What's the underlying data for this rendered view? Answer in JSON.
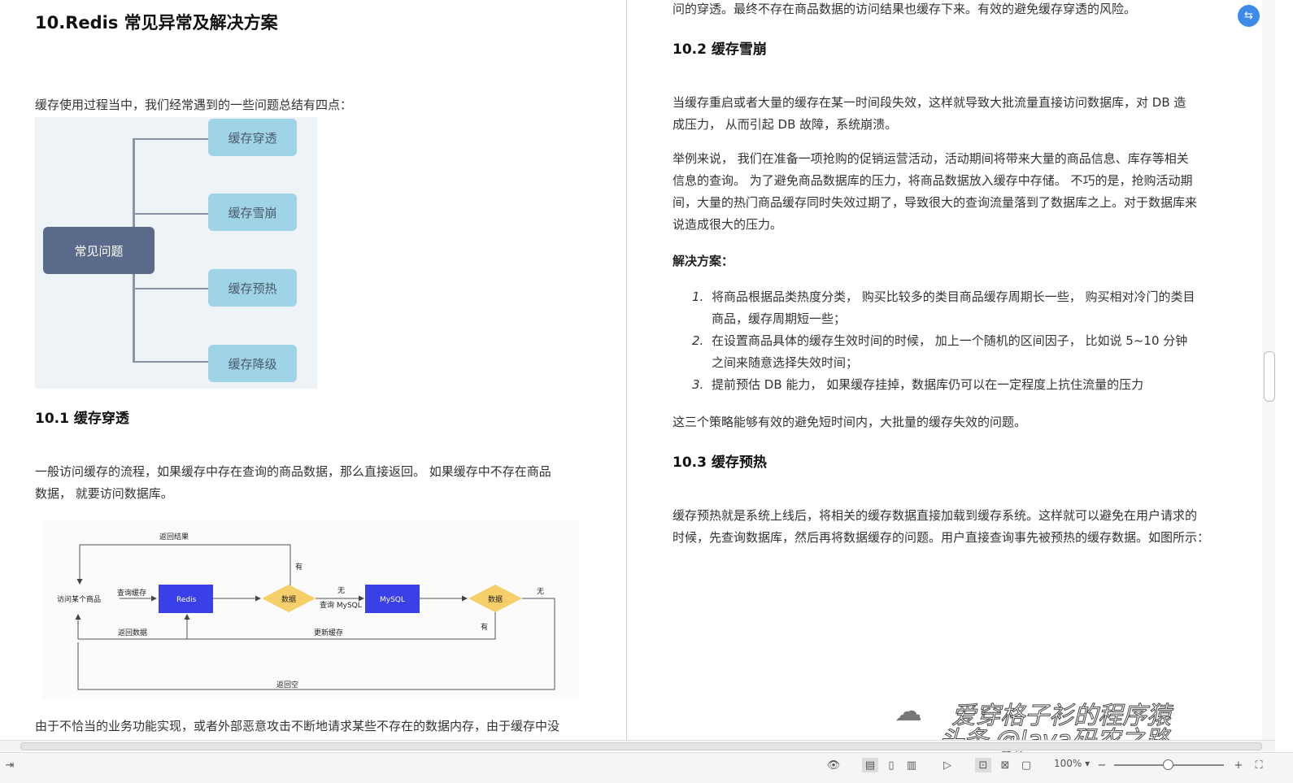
{
  "left_page": {
    "section_title": "10.Redis 常见异常及解决方案",
    "intro": "缓存使用过程当中，我们经常遇到的一些问题总结有四点：",
    "mindmap": {
      "root": "常见问题",
      "nodes": [
        "缓存穿透",
        "缓存雪崩",
        "缓存预热",
        "缓存降级"
      ]
    },
    "sub_title_1": "10.1  缓存穿透",
    "para_1a": "一般访问缓存的流程，如果缓存中存在查询的商品数据，那么直接返回。  如果缓存中不存在商品",
    "para_1b": "数据，  就要访问数据库。",
    "flow": {
      "start": "访问某个商品",
      "query_cache": "查询缓存",
      "redis": "Redis",
      "data1": "数据",
      "yes1": "有",
      "no1": "无",
      "query_mysql": "查询 MySQL",
      "mysql": "MySQL",
      "data2": "数据",
      "no2": "无",
      "yes2": "有",
      "return_result": "返回结果",
      "return_data": "返回数据",
      "update_cache": "更新缓存",
      "return_empty": "返回空"
    },
    "para_2": "由于不恰当的业务功能实现，或者外部恶意攻击不断地请求某些不存在的数据内存，由于缓存中没"
  },
  "right_page": {
    "top_line": "问的穿透。最终不存在商品数据的访问结果也缓存下来。有效的避免缓存穿透的风险。",
    "sub_title_2": "10.2  缓存雪崩",
    "para_a1": "当缓存重启或者大量的缓存在某一时间段失效，这样就导致大批流量直接访问数据库，对  DB  造",
    "para_a2": "成压力，  从而引起  DB  故障，系统崩溃。",
    "para_b1": "举例来说，  我们在准备一项抢购的促销运营活动，活动期间将带来大量的商品信息、库存等相关",
    "para_b2": "信息的查询。  为了避免商品数据库的压力，将商品数据放入缓存中存储。  不巧的是，抢购活动期",
    "para_b3": "间，大量的热门商品缓存同时失效过期了，导致很大的查询流量落到了数据库之上。对于数据库来",
    "para_b4": "说造成很大的压力。",
    "solution_label": "解决方案：",
    "list": [
      {
        "num": "1.",
        "l1": "将商品根据品类热度分类，  购买比较多的类目商品缓存周期长一些，  购买相对冷门的类目",
        "l2": "商品，缓存周期短一些；"
      },
      {
        "num": "2.",
        "l1": "在设置商品具体的缓存生效时间的时候，  加上一个随机的区间因子，  比如说  5~10  分钟",
        "l2": "之间来随意选择失效时间；"
      },
      {
        "num": "3.",
        "l1": "提前预估  DB  能力，  如果缓存挂掉，数据库仍可以在一定程度上抗住流量的压力",
        "l2": ""
      }
    ],
    "para_c": "这三个策略能够有效的避免短时间内，大批量的缓存失效的问题。",
    "sub_title_3": "10.3  缓存预热",
    "para_d1": "缓存预热就是系统上线后，将相关的缓存数据直接加载到缓存系统。这样就可以避免在用户请求的",
    "para_d2": "时候，先查询数据库，然后再将数据缓存的问题。用户直接查询事先被预热的缓存数据。如图所示："
  },
  "statusbar": {
    "zoom": "100%",
    "zoom_caret": "▾",
    "icons": [
      "eye-icon",
      "page-view-icon",
      "doc-view-icon",
      "book-view-icon",
      "play-icon",
      "fit-page-icon",
      "fit-width-icon",
      "crop-icon",
      "zoom-out-icon",
      "zoom-in-icon",
      "fullscreen-icon"
    ]
  },
  "watermark": {
    "line1": "爱穿格子衫的程序猿",
    "line2": "头条 @Java码农之路"
  }
}
